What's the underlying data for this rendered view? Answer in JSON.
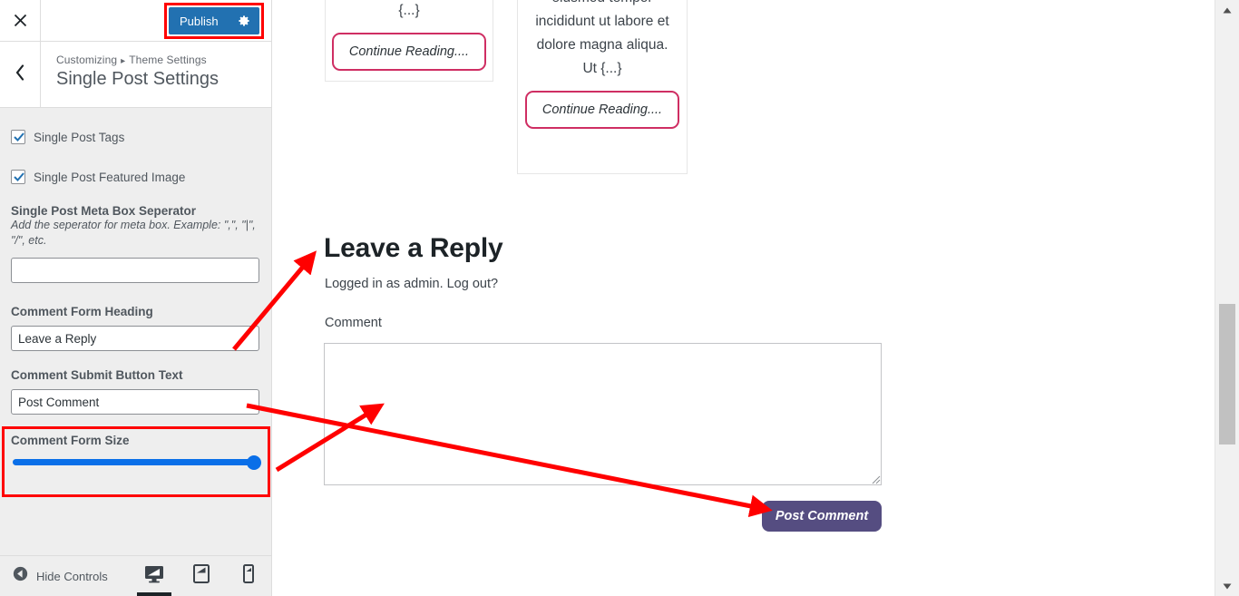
{
  "customizer": {
    "close_icon": "close-x-icon",
    "publish_label": "Publish",
    "publish_gear_icon": "gear-icon",
    "back_icon": "chevron-left-icon",
    "breadcrumb_root": "Customizing",
    "breadcrumb_sep": "▸",
    "breadcrumb_parent": "Theme Settings",
    "panel_title": "Single Post Settings",
    "accent_blue": "#2271b1",
    "slider_blue": "#0a6fe8",
    "annotation_red": "#ff0000"
  },
  "controls": {
    "checkbox_tags_label": "Single Post Tags",
    "checkbox_tags_checked": "checked",
    "checkbox_featured_label": "Single Post Featured Image",
    "checkbox_featured_checked": "checked",
    "separator_label": "Single Post Meta Box Seperator",
    "separator_desc": "Add the seperator for meta box. Example: \",\", \"|\", \"/\", etc.",
    "separator_value": "",
    "separator_placeholder": "",
    "heading_label": "Comment Form Heading",
    "heading_value": "Leave a Reply",
    "submit_label": "Comment Submit Button Text",
    "submit_value": "Post Comment",
    "size_label": "Comment Form Size",
    "size_value": "100",
    "size_min": "0",
    "size_max": "100"
  },
  "footer": {
    "hide_controls_label": "Hide Controls",
    "hide_controls_icon": "arrow-left-circle-icon",
    "device_desktop": "desktop-icon",
    "device_tablet": "tablet-icon",
    "device_mobile": "mobile-icon",
    "active_device": "desktop"
  },
  "preview": {
    "card_1": {
      "excerpt": "it, then start writing! {...}",
      "button_label": "Continue Reading...."
    },
    "card_2": {
      "excerpt": "adipiscing elit, sed do eiusmod tempor incididunt ut labore et dolore magna aliqua. Ut {...}",
      "button_label": "Continue Reading...."
    },
    "reply_heading": "Leave a Reply",
    "logged_in_text": "Logged in as admin. Log out?",
    "comment_field_label": "Comment",
    "comment_value": "",
    "post_button_label": "Post Comment",
    "post_button_color": "#554d81",
    "continue_border_color": "#cf2e63"
  },
  "scrollbar": {
    "up_icon": "scroll-up-arrow-icon",
    "down_icon": "scroll-down-arrow-icon"
  }
}
